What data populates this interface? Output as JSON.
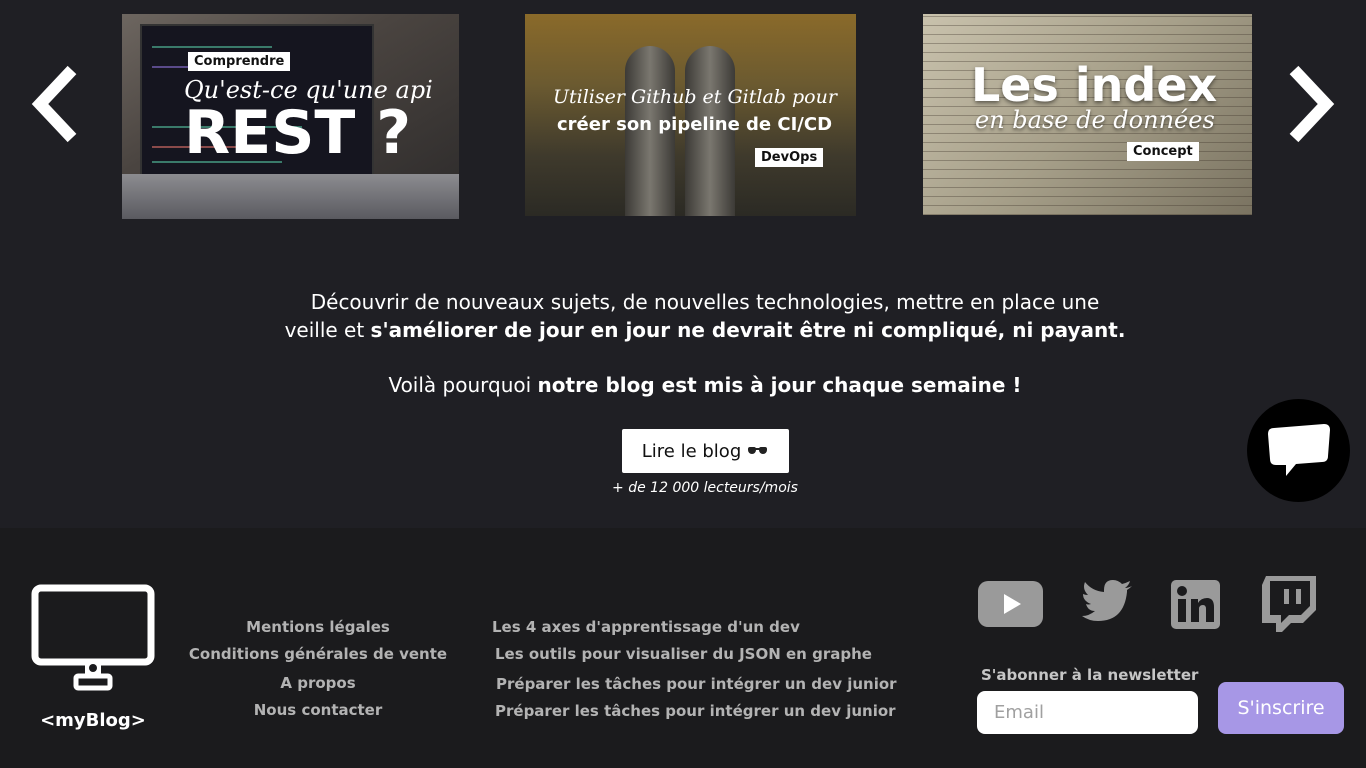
{
  "carousel": {
    "prev_icon": "chevron-left-icon",
    "next_icon": "chevron-right-icon",
    "cards": [
      {
        "tag": "Comprendre",
        "script": "Qu'est-ce qu'une api",
        "title": "REST ?"
      },
      {
        "script": "Utiliser Github et Gitlab pour",
        "title": "créer son pipeline de CI/CD",
        "tag": "DevOps"
      },
      {
        "title": "Les index",
        "script": "en base de données",
        "tag": "Concept"
      }
    ]
  },
  "intro": {
    "line1_plain": "Découvrir de nouveaux sujets, de nouvelles technologies, mettre en place une veille et ",
    "line1_bold": "s'améliorer de jour en jour ne devrait être ni compliqué, ni payant.",
    "line2_plain": "Voilà pourquoi ",
    "line2_bold": "notre blog est mis à jour chaque semaine !"
  },
  "cta": {
    "label": "Lire le blog",
    "icon": "sunglasses-icon",
    "subtext": "+ de 12 000 lecteurs/mois"
  },
  "chat": {
    "icon": "chat-bubble-icon"
  },
  "footer": {
    "logo_icon": "monitor-icon",
    "brand": "<myBlog>",
    "links_col1": [
      "Mentions légales",
      "Conditions générales de vente",
      "A propos",
      "Nous contacter"
    ],
    "links_col2": [
      "Les 4 axes d'apprentissage d'un dev",
      "Les outils pour visualiser du JSON en graphe",
      "Préparer les tâches pour intégrer un dev junior",
      "Préparer les tâches pour intégrer un dev junior"
    ],
    "social": [
      "youtube-icon",
      "twitter-icon",
      "linkedin-icon",
      "twitch-icon"
    ],
    "newsletter_label": "S'abonner à la newsletter",
    "email_placeholder": "Email",
    "subscribe_label": "S'inscrire"
  },
  "colors": {
    "background": "#1f1f24",
    "footer": "#1b1b1d",
    "accent": "#a797e6",
    "link": "#b3b3b3",
    "icon_gray": "#9a9a9a"
  }
}
